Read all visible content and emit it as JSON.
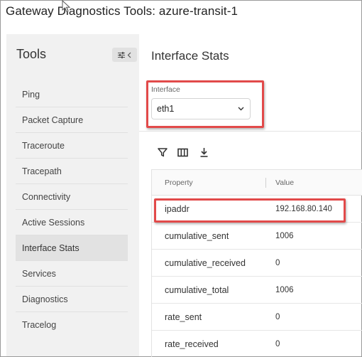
{
  "window": {
    "title": "Gateway Diagnostics Tools: azure-transit-1"
  },
  "sidebar": {
    "title": "Tools",
    "collapse_icon": "collapse-panel-icon",
    "items": [
      {
        "label": "Ping"
      },
      {
        "label": "Packet Capture"
      },
      {
        "label": "Traceroute"
      },
      {
        "label": "Tracepath"
      },
      {
        "label": "Connectivity"
      },
      {
        "label": "Active Sessions"
      },
      {
        "label": "Interface Stats",
        "active": true
      },
      {
        "label": "Services"
      },
      {
        "label": "Diagnostics"
      },
      {
        "label": "Tracelog"
      }
    ]
  },
  "main": {
    "title": "Interface Stats",
    "interface": {
      "label": "Interface",
      "value": "eth1"
    },
    "toolbar": {
      "icons": [
        "filter-icon",
        "columns-icon",
        "download-icon"
      ]
    },
    "table": {
      "headers": {
        "property": "Property",
        "value": "Value"
      },
      "rows": [
        {
          "property": "ipaddr",
          "value": "192.168.80.140"
        },
        {
          "property": "cumulative_sent",
          "value": "1006"
        },
        {
          "property": "cumulative_received",
          "value": "0"
        },
        {
          "property": "cumulative_total",
          "value": "1006"
        },
        {
          "property": "rate_sent",
          "value": "0"
        },
        {
          "property": "rate_received",
          "value": "0"
        }
      ]
    }
  },
  "colors": {
    "highlight": "#e24a4a",
    "sidebar_bg": "#f1f1f1",
    "active_item_bg": "#e2e2e2"
  }
}
